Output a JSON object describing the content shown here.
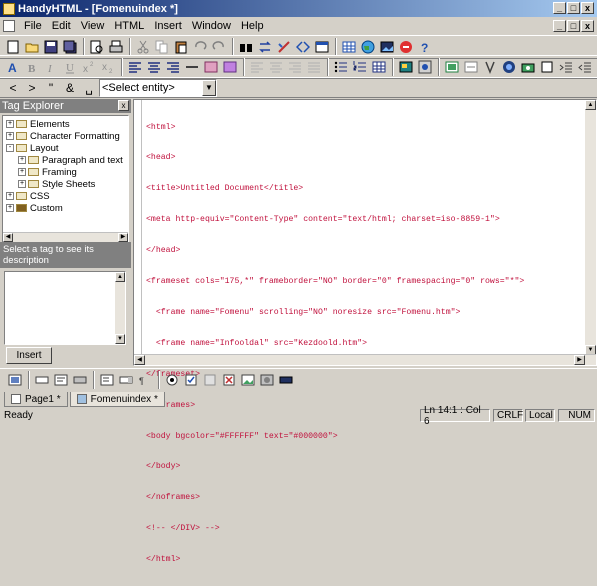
{
  "window": {
    "title": "HandyHTML - [Fomenuindex *]",
    "min": "_",
    "max": "□",
    "close": "x"
  },
  "menus": [
    "File",
    "Edit",
    "View",
    "HTML",
    "Insert",
    "Window",
    "Help"
  ],
  "toolbar1": {
    "icons": [
      "new-icon",
      "open-icon",
      "save-icon",
      "save-all-icon",
      "print-preview-icon",
      "print-icon",
      "cut-icon",
      "copy-icon",
      "paste-icon",
      "undo-icon",
      "redo-icon",
      "find-icon",
      "replace-icon",
      "spellcheck-icon",
      "tag-icon",
      "browser-icon",
      "table-icon",
      "globe-icon",
      "image-icon",
      "stop-icon",
      "help-icon"
    ]
  },
  "toolbar2": {
    "icons": [
      "bold-A-icon",
      "bold-icon",
      "italic-icon",
      "underline-icon",
      "superscript-icon",
      "subscript-icon",
      "align-left-icon",
      "align-center-icon",
      "align-right-icon",
      "hr-icon",
      "font-larger-icon",
      "font-smaller-icon",
      "justify-left-icon",
      "justify-center-icon",
      "justify-right-icon",
      "justify-full-icon",
      "unordered-list-icon",
      "ordered-list-icon",
      "table-icon",
      "image-insert-icon",
      "form-icon",
      "frame-icon",
      "anchor-icon",
      "color-icon",
      "image2-icon",
      "box-icon",
      "indent-icon",
      "outdent-icon"
    ]
  },
  "toolbar3": {
    "lt": "<",
    "gt": ">",
    "quote": "\"",
    "amp": "&",
    "space": "␣",
    "entity_select": "<Select entity>"
  },
  "tag_explorer": {
    "title": "Tag Explorer",
    "close": "x",
    "nodes": [
      {
        "label": "Elements",
        "pm": "+"
      },
      {
        "label": "Character Formatting",
        "pm": "+"
      },
      {
        "label": "Layout",
        "pm": "-"
      },
      {
        "label": "Paragraph and text",
        "pm": "+"
      },
      {
        "label": "Framing",
        "pm": "+"
      },
      {
        "label": "Style Sheets",
        "pm": "+"
      },
      {
        "label": "CSS",
        "pm": "+"
      },
      {
        "label": "Custom",
        "pm": "+"
      }
    ],
    "description_title": "Select a tag to see its description",
    "insert": "Insert"
  },
  "editor": {
    "lines": [
      "<html>",
      "<head>",
      "<title>Untitled Document</title>",
      "<meta http-equiv=\"Content-Type\" content=\"text/html; charset=iso-8859-1\">",
      "</head>",
      "<frameset cols=\"175,*\" frameborder=\"NO\" border=\"0\" framespacing=\"0\" rows=\"*\">",
      "  <frame name=\"Fomenu\" scrolling=\"NO\" noresize src=\"Fomenu.htm\">",
      "  <frame name=\"Infooldal\" src=\"Kezdoold.htm\">",
      "</frameset>",
      "<noframes>",
      "<body bgcolor=\"#FFFFFF\" text=\"#000000\">",
      "</body>",
      "</noframes>",
      "<!-- </DIV> -->",
      "</html>"
    ]
  },
  "tabs": [
    {
      "label": "Page1 *"
    },
    {
      "label": "Fomenuindex *"
    }
  ],
  "status": {
    "ready": "Ready",
    "position": "Ln 14:1 : Col 6",
    "crlf": "CRLF",
    "local": "Local",
    "num": "NUM"
  }
}
